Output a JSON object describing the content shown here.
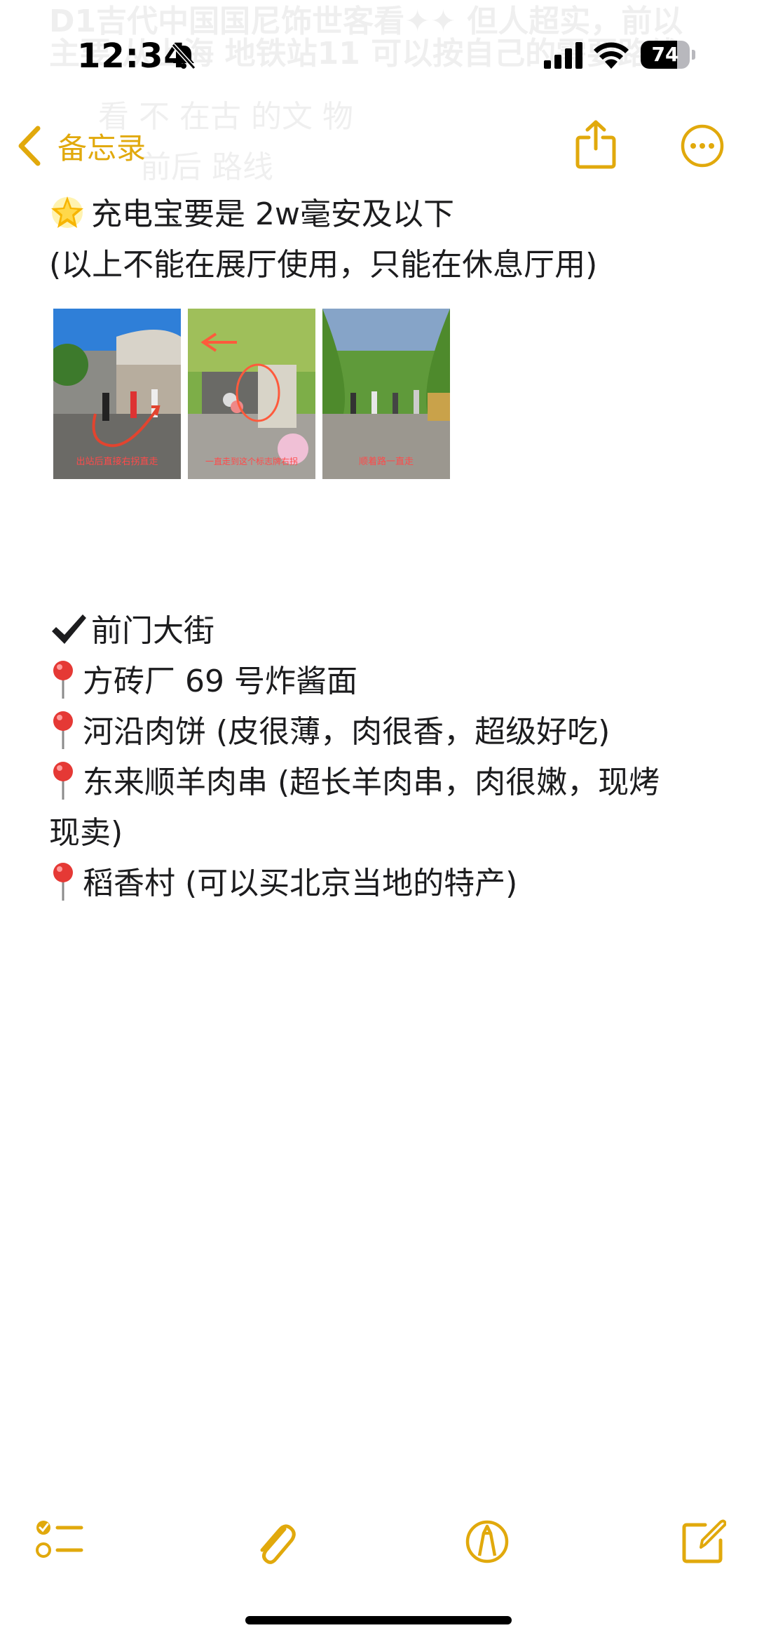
{
  "status_bar": {
    "time": "12:34",
    "battery": "74",
    "battery_level": 0.74
  },
  "ghost_text": {
    "line1": "D1吉代中国国尼饰世客看✦✦ 但人超实，前以",
    "line2": "主要 从上海 地铁站11 可以按自己的需要路线",
    "line3": "看 不 在古 的文 物",
    "line4": "前后 路线"
  },
  "nav": {
    "back_label": "备忘录"
  },
  "note": {
    "line_powerbank": "充电宝要是 2w毫安及以下",
    "line_note": "(以上不能在展厅使用，只能在休息厅用)",
    "images": [
      {
        "caption": "出站后直接右拐直走"
      },
      {
        "caption": "一直走到这个标志牌右拐"
      },
      {
        "caption": "顺着路一直走"
      }
    ],
    "section_title": "前门大街",
    "items": [
      "方砖厂 69 号炸酱面",
      "河沿肉饼 (皮很薄，肉很香，超级好吃)",
      "东来顺羊肉串 (超长羊肉串，肉很嫩，现烤现卖)",
      "稻香村 (可以买北京当地的特产)"
    ]
  },
  "colors": {
    "accent": "#e1a90c",
    "text": "#1c1c1e",
    "background": "#ffffff"
  },
  "toolbar": {
    "icons": [
      "checklist-icon",
      "paperclip-icon",
      "markup-pen-icon",
      "compose-icon"
    ]
  }
}
